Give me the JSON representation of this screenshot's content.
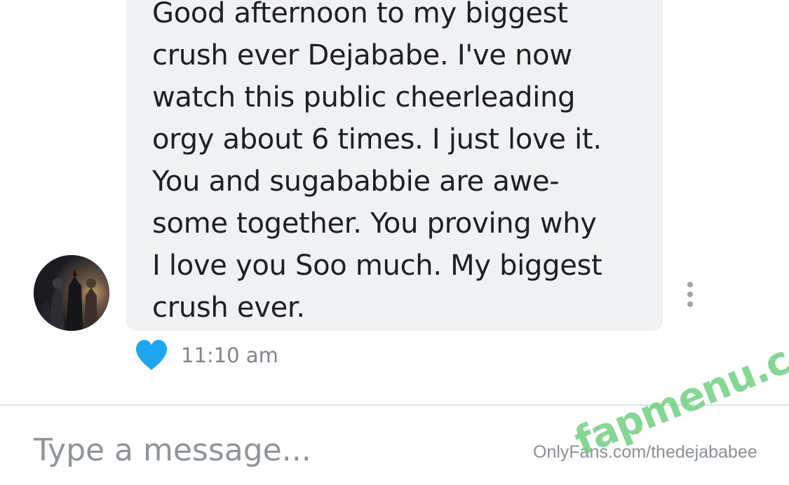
{
  "message": {
    "text": "Good afternoon to my biggest\ncrush ever Dejababe. I've now\nwatch this public cheerleading\norgy about 6 times. I just love it.\nYou and sugababbie are awe-\nsome together. You proving why\nI love you Soo much. My biggest\ncrush ever.",
    "timestamp": "11:10 am",
    "liked": true
  },
  "composer": {
    "placeholder": "Type a message..."
  },
  "watermarks": {
    "credit": "OnlyFans.com/thedejababee",
    "site": "fapmenu.com"
  },
  "colors": {
    "bubble": "#eff1f2",
    "heart": "#1ea7f0",
    "timestamp": "#7f868c",
    "placeholder": "#8d9499",
    "site_watermark": "#63cc76"
  },
  "icons": {
    "like": "heart-icon",
    "more": "vertical-ellipsis-icon"
  }
}
